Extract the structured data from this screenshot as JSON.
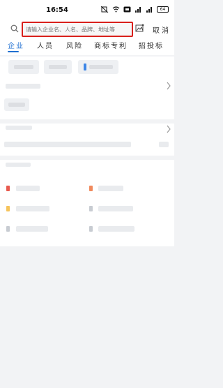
{
  "status_bar": {
    "time": "16:54",
    "battery": "64",
    "icons": [
      "mute-icon",
      "wifi-icon",
      "hd-icon",
      "signal-icon",
      "signal-icon"
    ]
  },
  "search": {
    "placeholder": "请输入企业名、人名、品牌、地址等",
    "cancel_label": "取消",
    "icons": [
      "search-icon",
      "image-search-icon"
    ]
  },
  "tabs": [
    {
      "label": "企业",
      "active": true
    },
    {
      "label": "人员",
      "active": false
    },
    {
      "label": "风险",
      "active": false
    },
    {
      "label": "商标专利",
      "active": false
    },
    {
      "label": "招投标",
      "active": false
    }
  ],
  "colors": {
    "accent": "#1f6fd1",
    "highlight": "#d9201c",
    "background": "#f2f3f5"
  },
  "section_more_icon": "chevron-icon"
}
